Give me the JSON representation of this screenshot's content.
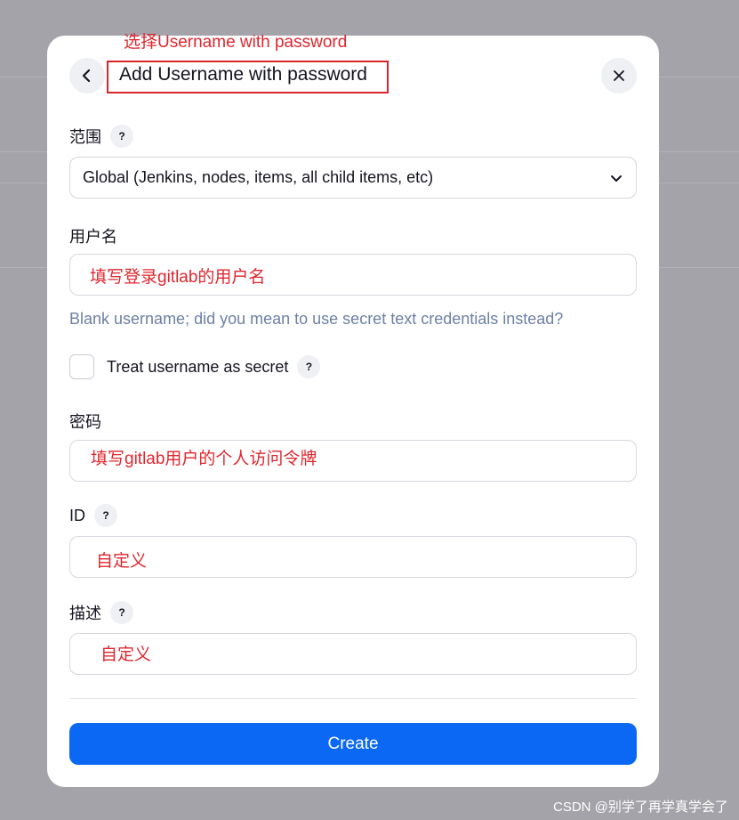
{
  "dialog": {
    "title": "Add Username with password",
    "annotation_title": "选择Username with password",
    "back_icon": "chevron-left-icon",
    "close_icon": "close-icon",
    "help_glyph": "?"
  },
  "scope": {
    "label": "范围",
    "selected": "Global (Jenkins, nodes, items, all child items, etc)"
  },
  "username": {
    "label": "用户名",
    "value": "",
    "annotation": "填写登录gitlab的用户名",
    "hint": "Blank username; did you mean to use secret text credentials instead?"
  },
  "treat_secret": {
    "label": "Treat username as secret",
    "checked": false
  },
  "password": {
    "label": "密码",
    "annotation": "填写gitlab用户的个人访问令牌"
  },
  "id_field": {
    "label": "ID",
    "annotation": "自定义"
  },
  "description": {
    "label": "描述",
    "annotation": "自定义"
  },
  "actions": {
    "create_label": "Create",
    "primary_color": "#0a68f5"
  },
  "watermark": "CSDN @别学了再学真学会了",
  "colors": {
    "annotation": "#e0262e",
    "hint": "#6d80a5"
  }
}
